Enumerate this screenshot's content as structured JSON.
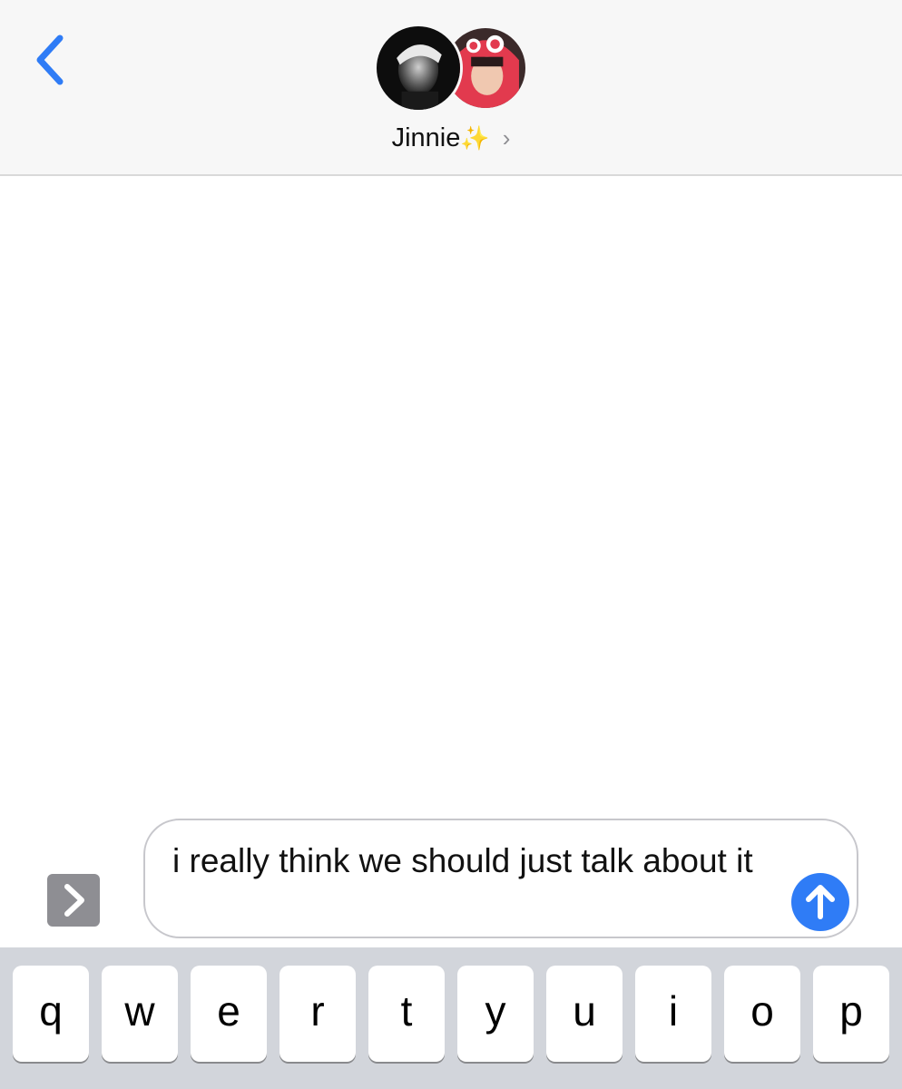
{
  "header": {
    "back_icon": "chevron-left-icon",
    "contact_name": "Jinnie",
    "contact_emoji": "✨",
    "details_chevron": "›",
    "avatars": [
      "avatar-1",
      "avatar-2"
    ]
  },
  "compose": {
    "expand_icon": "chevron-right-icon",
    "message_text": "i really think we should just talk about it",
    "send_icon": "arrow-up-icon"
  },
  "keyboard": {
    "row1": [
      "q",
      "w",
      "e",
      "r",
      "t",
      "y",
      "u",
      "i",
      "o",
      "p"
    ]
  },
  "colors": {
    "accent": "#2f7cf6",
    "header_bg": "#f7f7f7",
    "keyboard_bg": "#d2d5db"
  }
}
